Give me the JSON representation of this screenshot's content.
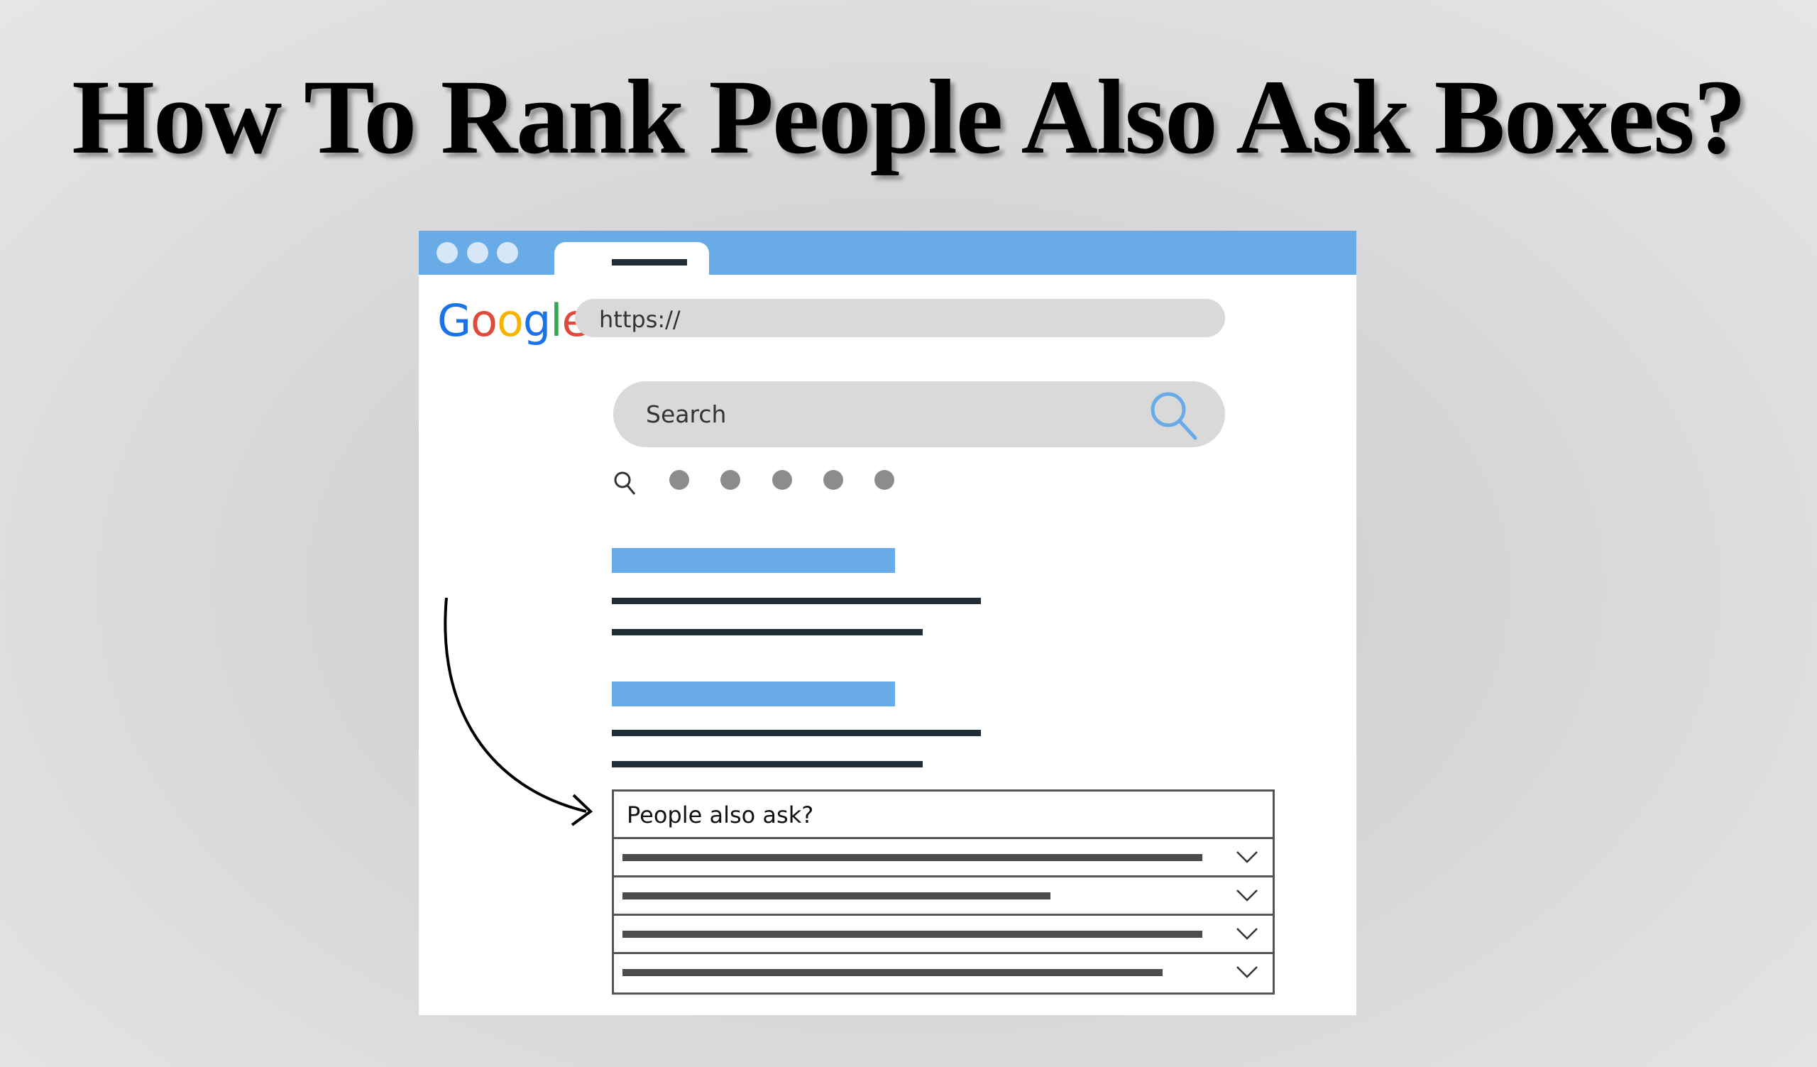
{
  "title": "How To Rank People Also Ask Boxes?",
  "browser": {
    "window_dots": 3,
    "url_text": "https://",
    "logo": {
      "letters": [
        {
          "char": "G",
          "color": "#1a73e8"
        },
        {
          "char": "o",
          "color": "#e04a3b"
        },
        {
          "char": "o",
          "color": "#f4b400"
        },
        {
          "char": "g",
          "color": "#1a73e8"
        },
        {
          "char": "l",
          "color": "#34a853"
        },
        {
          "char": "e",
          "color": "#e04a3b"
        }
      ]
    },
    "search_placeholder": "Search",
    "icons": {
      "search": "search-icon",
      "tool_search": "search-icon-small"
    }
  },
  "paa": {
    "heading": "People also ask?",
    "rows": [
      {
        "fill": 0.88
      },
      {
        "fill": 0.65
      },
      {
        "fill": 0.88
      },
      {
        "fill": 0.82
      }
    ]
  },
  "colors": {
    "accent_blue": "#69abe6",
    "dark_line": "#1e2d36",
    "bar_gray": "#d9d9d9"
  }
}
